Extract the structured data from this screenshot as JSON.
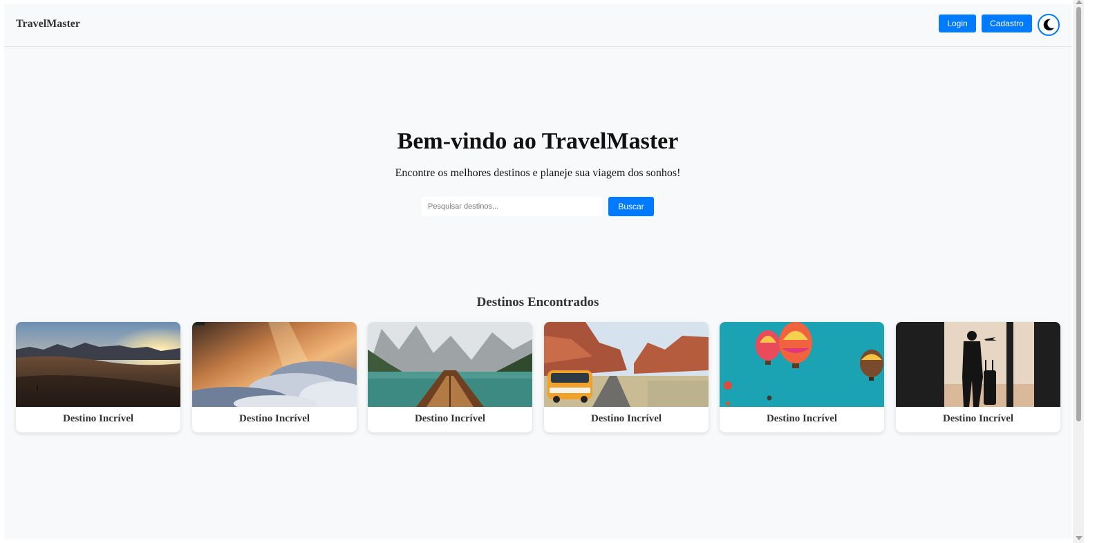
{
  "navbar": {
    "brand": "TravelMaster",
    "login_label": "Login",
    "signup_label": "Cadastro",
    "theme_icon": "moon-icon"
  },
  "hero": {
    "title": "Bem-vindo ao TravelMaster",
    "subtitle": "Encontre os melhores destinos e planeje sua viagem dos sonhos!",
    "search_placeholder": "Pesquisar destinos...",
    "search_value": "",
    "search_button": "Buscar"
  },
  "destinations": {
    "title": "Destinos Encontrados",
    "cards": [
      {
        "title": "Destino Incrível",
        "image": "desert-sunset-photo"
      },
      {
        "title": "Destino Incrível",
        "image": "clouds-sunset-photo"
      },
      {
        "title": "Destino Incrível",
        "image": "mountain-lake-boat-photo"
      },
      {
        "title": "Destino Incrível",
        "image": "canyon-van-road-photo"
      },
      {
        "title": "Destino Incrível",
        "image": "hot-air-balloons-photo"
      },
      {
        "title": "Destino Incrível",
        "image": "traveler-silhouette-photo"
      }
    ]
  },
  "colors": {
    "accent": "#007bff",
    "background": "#f8f9fa"
  }
}
